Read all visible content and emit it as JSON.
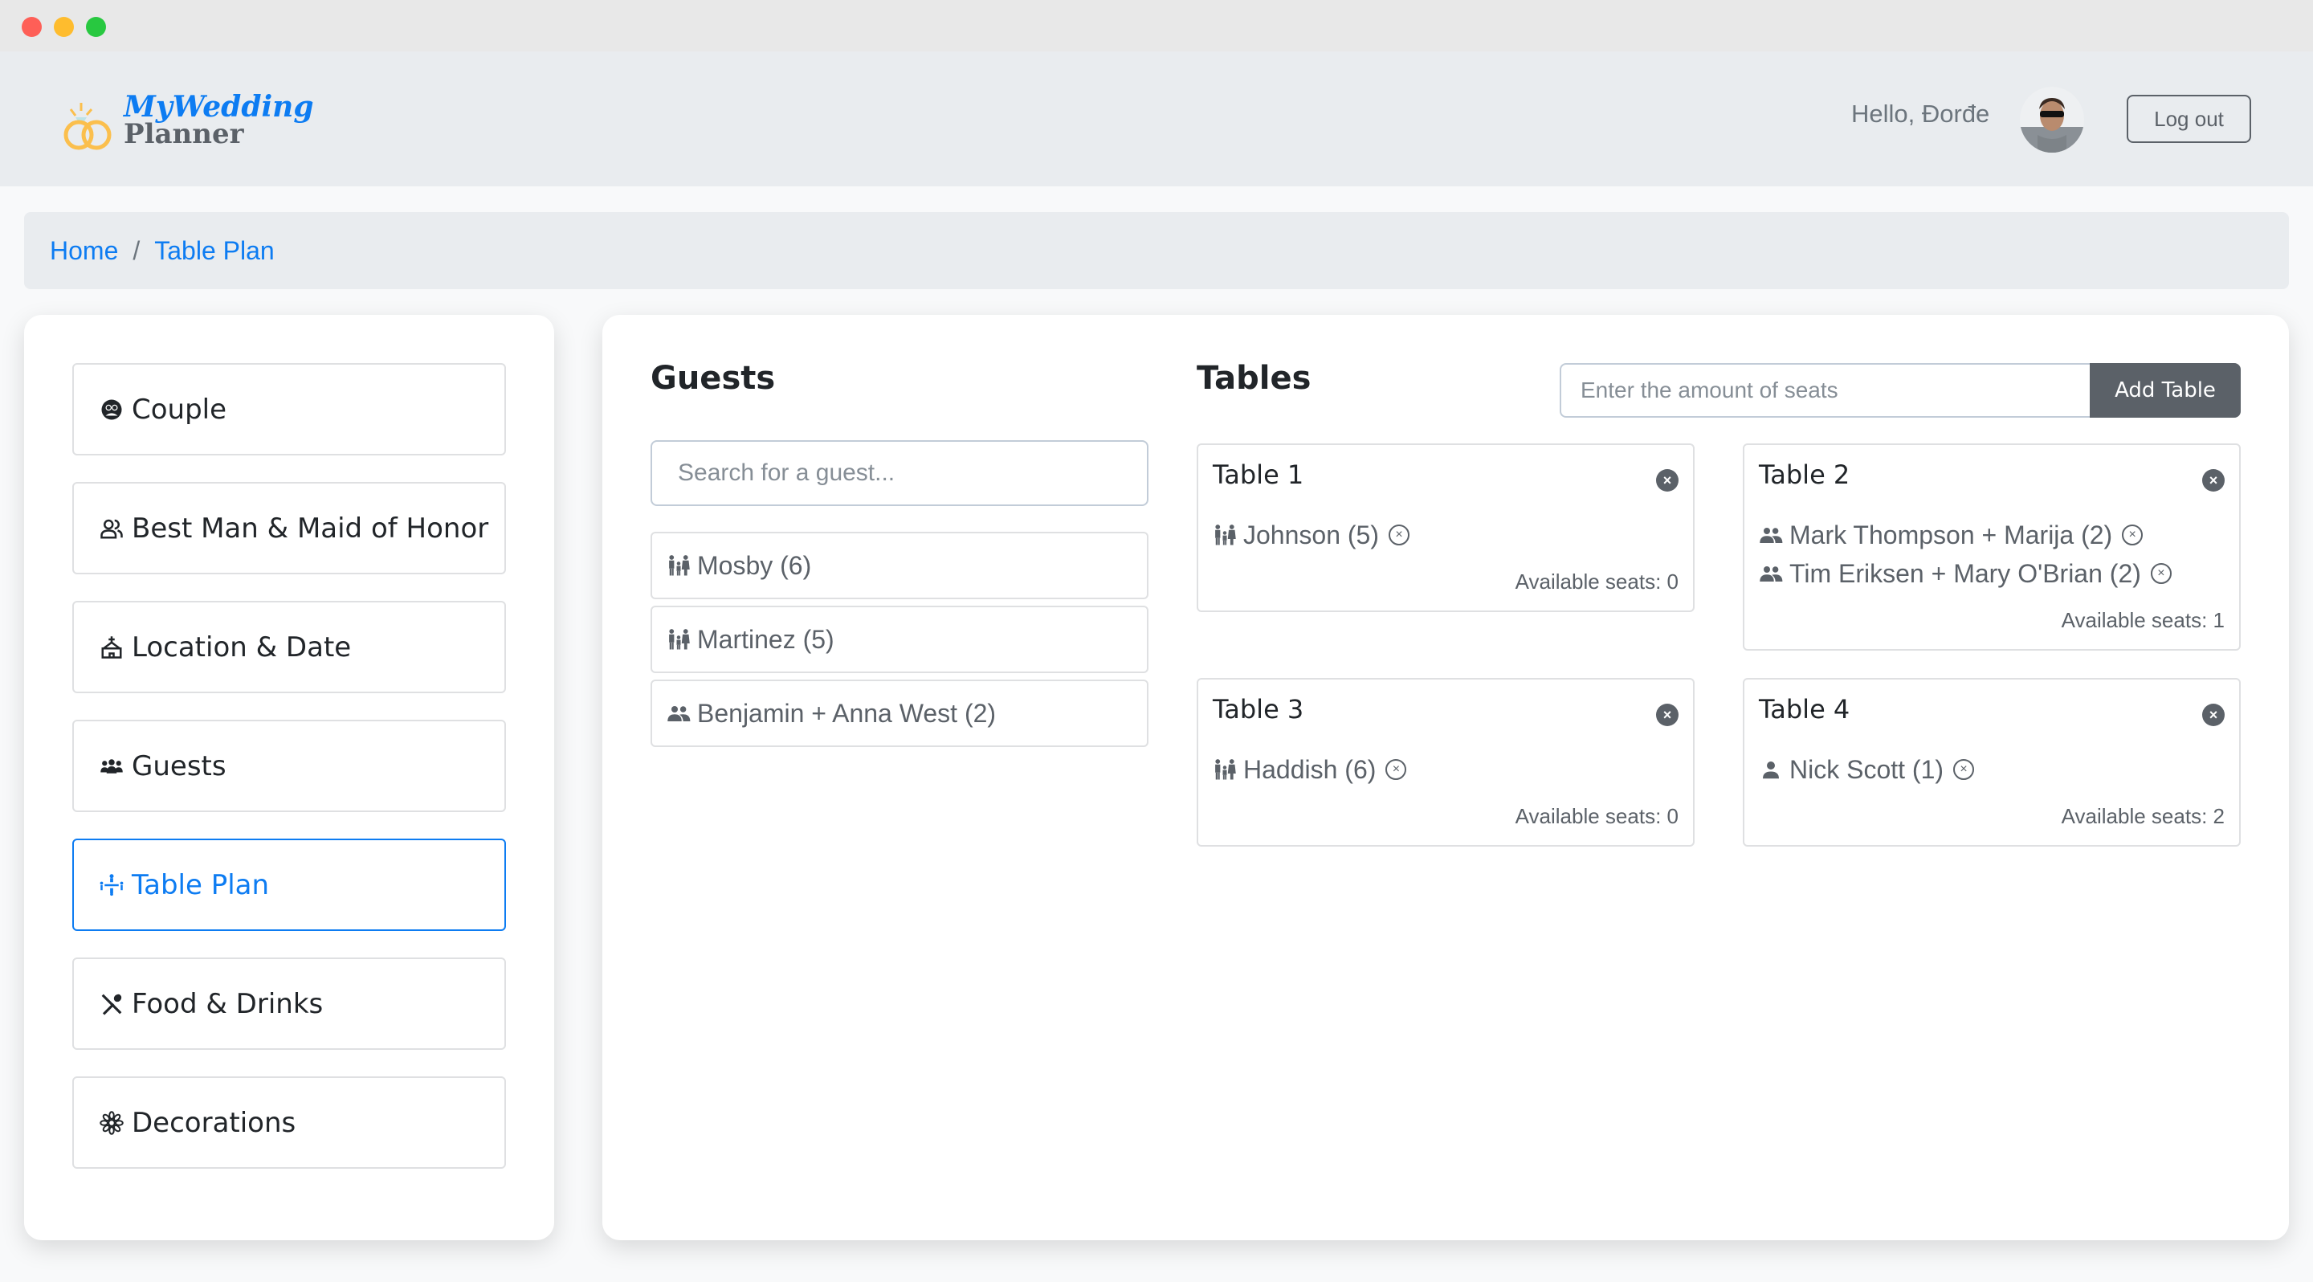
{
  "window": {
    "controls": [
      "close",
      "minimize",
      "maximize"
    ]
  },
  "header": {
    "logo": {
      "line1": "MyWedding",
      "line2": "Planner",
      "icon": "wedding-rings-icon"
    },
    "greeting": "Hello, Đorđe",
    "avatar_alt": "user-avatar",
    "logout_label": "Log out"
  },
  "breadcrumb": {
    "items": [
      {
        "label": "Home"
      },
      {
        "label": "Table Plan"
      }
    ],
    "separator": "/"
  },
  "sidebar": {
    "items": [
      {
        "label": "Couple",
        "icon": "couple-icon",
        "active": false
      },
      {
        "label": "Best Man & Maid of Honor",
        "icon": "people-icon",
        "active": false
      },
      {
        "label": "Location & Date",
        "icon": "church-icon",
        "active": false
      },
      {
        "label": "Guests",
        "icon": "group-icon",
        "active": false
      },
      {
        "label": "Table Plan",
        "icon": "table-seating-icon",
        "active": true
      },
      {
        "label": "Food & Drinks",
        "icon": "utensils-icon",
        "active": false
      },
      {
        "label": "Decorations",
        "icon": "flower-icon",
        "active": false
      }
    ]
  },
  "guests": {
    "title": "Guests",
    "search_placeholder": "Search for a guest...",
    "search_value": "",
    "list": [
      {
        "label": "Mosby (6)",
        "icon": "family-icon"
      },
      {
        "label": "Martinez (5)",
        "icon": "family-icon"
      },
      {
        "label": "Benjamin + Anna West (2)",
        "icon": "pair-icon"
      }
    ]
  },
  "tables": {
    "title": "Tables",
    "seats_placeholder": "Enter the amount of seats",
    "seats_value": "",
    "add_label": "Add Table",
    "remove_glyph": "×",
    "items": [
      {
        "name": "Table 1",
        "available": "Available seats: 0",
        "guests": [
          {
            "label": "Johnson (5)",
            "icon": "family-icon"
          }
        ]
      },
      {
        "name": "Table 2",
        "available": "Available seats: 1",
        "guests": [
          {
            "label": "Mark Thompson + Marija (2)",
            "icon": "pair-icon"
          },
          {
            "label": "Tim Eriksen + Mary O'Brian (2)",
            "icon": "pair-icon"
          }
        ]
      },
      {
        "name": "Table 3",
        "available": "Available seats: 0",
        "guests": [
          {
            "label": "Haddish (6)",
            "icon": "family-icon"
          }
        ]
      },
      {
        "name": "Table 4",
        "available": "Available seats: 2",
        "guests": [
          {
            "label": "Nick Scott (1)",
            "icon": "person-icon"
          }
        ]
      }
    ]
  },
  "colors": {
    "accent": "#0d7cf2",
    "secondary": "#5b6168",
    "header_bg": "#e9ecef",
    "logo_gold": "#fbbf4d"
  }
}
